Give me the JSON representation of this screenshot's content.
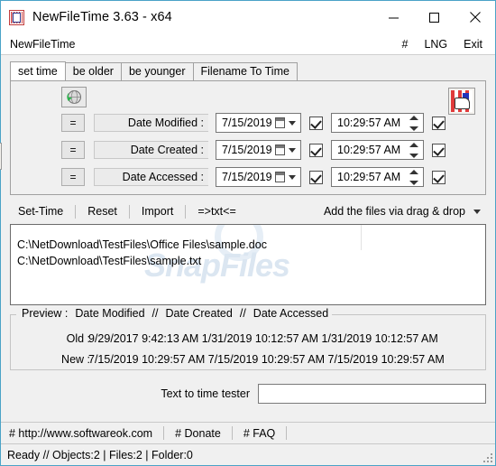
{
  "window": {
    "title": "NewFileTime 3.63 - x64",
    "icon": "app-calendar-icon",
    "minimize": "minimize-icon",
    "maximize": "maximize-icon",
    "close": "close-icon"
  },
  "menubar": {
    "app_name": "NewFileTime",
    "items": [
      {
        "label": "#"
      },
      {
        "label": "LNG"
      },
      {
        "label": "Exit"
      }
    ]
  },
  "tabs": [
    {
      "label": "set time",
      "active": true
    },
    {
      "label": "be older",
      "active": false
    },
    {
      "label": "be younger",
      "active": false
    },
    {
      "label": "Filename To Time",
      "active": false
    }
  ],
  "set_time": {
    "refresh_icon": "globe-refresh-icon",
    "drag_icon_top_right": "checker-hand-icon",
    "drag_icon_left": "checker-hand-icon",
    "rows": [
      {
        "equals_button": "=",
        "label": "Date Modified :",
        "date": "7/15/2019",
        "date_checkbox": true,
        "time": "10:29:57 AM",
        "time_checkbox": true
      },
      {
        "equals_button": "=",
        "label": "Date Created :",
        "date": "7/15/2019",
        "date_checkbox": true,
        "time": "10:29:57 AM",
        "time_checkbox": true
      },
      {
        "equals_button": "=",
        "label": "Date Accessed :",
        "date": "7/15/2019",
        "date_checkbox": true,
        "time": "10:29:57 AM",
        "time_checkbox": true
      }
    ]
  },
  "actionbar": {
    "buttons": [
      {
        "label": "Set-Time"
      },
      {
        "label": "Reset"
      },
      {
        "label": "Import"
      },
      {
        "label": "=>txt<="
      }
    ],
    "dropdown": "Add the files via drag & drop"
  },
  "filelist": {
    "files": [
      "C:\\NetDownload\\TestFiles\\Office Files\\sample.doc",
      "C:\\NetDownload\\TestFiles\\sample.txt"
    ],
    "watermark": "SnapFiles"
  },
  "preview": {
    "legend_prefix": "Preview :",
    "legend_col1": "Date Modified",
    "legend_sep1": "//",
    "legend_col2": "Date Created",
    "legend_sep2": "//",
    "legend_col3": "Date Accessed",
    "old_label": "Old :",
    "old_values": "9/29/2017 9:42:13 AM   1/31/2019 10:12:57 AM 1/31/2019 10:12:57 AM",
    "new_label": "New :",
    "new_values": "7/15/2019 10:29:57 AM 7/15/2019 10:29:57 AM 7/15/2019 10:29:57 AM"
  },
  "tester": {
    "label": "Text to time tester",
    "value": "",
    "placeholder": ""
  },
  "links": [
    {
      "label": "# http://www.softwareok.com"
    },
    {
      "label": "# Donate"
    },
    {
      "label": "# FAQ"
    }
  ],
  "status": {
    "text": "Ready // Objects:2 | Files:2  | Folder:0"
  },
  "colors": {
    "window_border": "#4aa3c7",
    "face": "#f0f0f0",
    "accent_red": "#e03a3a",
    "watermark": "#d6e3ef"
  }
}
